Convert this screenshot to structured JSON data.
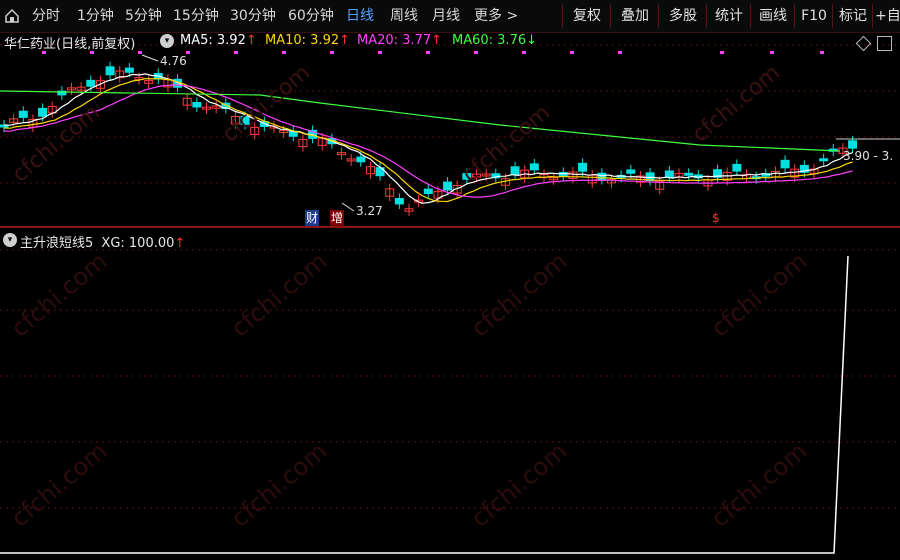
{
  "toolbar": {
    "periods": [
      "分时",
      "1分钟",
      "5分钟",
      "15分钟",
      "30分钟",
      "60分钟",
      "日线",
      "周线",
      "月线",
      "更多"
    ],
    "more_arrow": ">",
    "active_period": "日线",
    "tools": [
      "复权",
      "叠加",
      "多股",
      "统计",
      "画线",
      "F10",
      "标记",
      "+自选"
    ]
  },
  "main_chart": {
    "title": "华仁药业(日线,前复权)",
    "ma": [
      {
        "label": "MA5: 3.92",
        "arrow": "↑",
        "color": "#ffffff",
        "arrow_color": "#ff3030"
      },
      {
        "label": "MA10: 3.92",
        "arrow": "↑",
        "color": "#ffd700",
        "arrow_color": "#ff3030"
      },
      {
        "label": "MA20: 3.77",
        "arrow": "↑",
        "color": "#ff40ff",
        "arrow_color": "#ff3030"
      },
      {
        "label": "MA60: 3.76",
        "arrow": "↓",
        "color": "#40ff40",
        "arrow_color": "#40ff40"
      }
    ],
    "high_label": "4.76",
    "low_label": "3.27",
    "range_label": "3.90 - 3.",
    "badges": {
      "cai": "财",
      "zeng": "增",
      "dollar": "$"
    }
  },
  "indicator": {
    "title": "主升浪短线5",
    "xg_label": "XG: 100.00",
    "xg_arrow": "↑"
  },
  "watermark": "cfchi.com",
  "colors": {
    "up": "#ff3c3c",
    "down": "#00e0e0",
    "grid": "#5a1010",
    "active_tab": "#4fa3ff"
  }
}
